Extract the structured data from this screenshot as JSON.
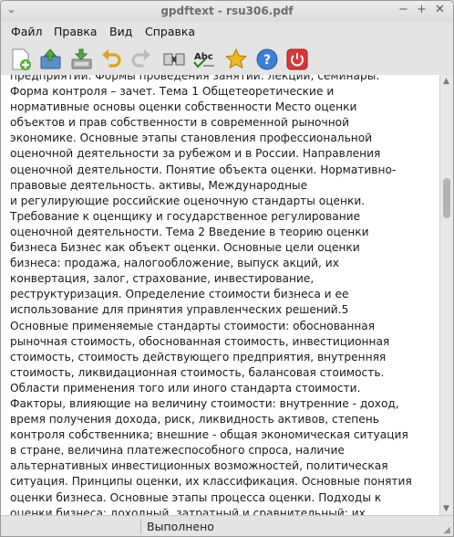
{
  "window": {
    "title": "gpdftext - rsu306.pdf",
    "controls": [
      "⌄",
      "−",
      "+",
      "✕"
    ]
  },
  "menu": [
    "Файл",
    "Правка",
    "Вид",
    "Справка"
  ],
  "toolbar": {
    "buttons": [
      "new-file",
      "open-file",
      "save-file",
      "undo",
      "redo",
      "spell-toggle",
      "spell-check",
      "bookmark-star",
      "help",
      "quit"
    ],
    "spell_label": "Abc"
  },
  "document": {
    "lines": [
      "предприятии. Формы проведения занятий: лекции, семинары.",
      "Форма контроля – зачет. Тема 1 Общетеоретические и",
      "нормативные основы оценки собственности Место оценки",
      "объектов и прав собственности в современной рыночной",
      "экономике. Основные этапы становления профессиональной",
      "оценочной деятельности за рубежом и в России. Направления",
      "оценочной деятельности. Понятие объекта оценки. Нормативно-",
      "правовые деятельность. активы, Международные",
      "и регулирующие российские оценочную стандарты оценки.",
      "Требование к оценщику и государственное регулирование",
      "оценочной деятельности. Тема 2 Введение в теорию оценки",
      "бизнеса Бизнес как объект оценки. Основные цели оценки",
      "бизнеса: продажа, налогообложение, выпуск акций, их",
      "конвертация, залог, страхование, инвестирование,",
      "реструктуризация. Определение стоимости бизнеса и ее",
      "использование для принятия управленческих решений.5",
      "Основные применяемые стандарты стоимости: обоснованная",
      "рыночная стоимость, обоснованная стоимость, инвестиционная",
      "стоимость, стоимость действующего предприятия, внутренняя",
      "стоимость, ликвидационная стоимость, балансовая стоимость.",
      "Области применения того или иного стандарта стоимости.",
      "Факторы, влияющие на величину стоимости: внутренние - доход,",
      "время получения дохода, риск, ликвидность активов, степень",
      "контроля собственника; внешние - общая экономическая ситуация",
      "в стране, величина платежеспособного спроса, наличие",
      "альтернативных инвестиционных возможностей, политическая",
      "ситуация. Принципы оценки, их классификация. Основные понятия",
      "оценки бизнеса. Основные этапы процесса оценки. Подходы к",
      "оценки бизнеса: доходный, затратный и сравнительный; их"
    ]
  },
  "status": {
    "text": "Выполнено"
  }
}
